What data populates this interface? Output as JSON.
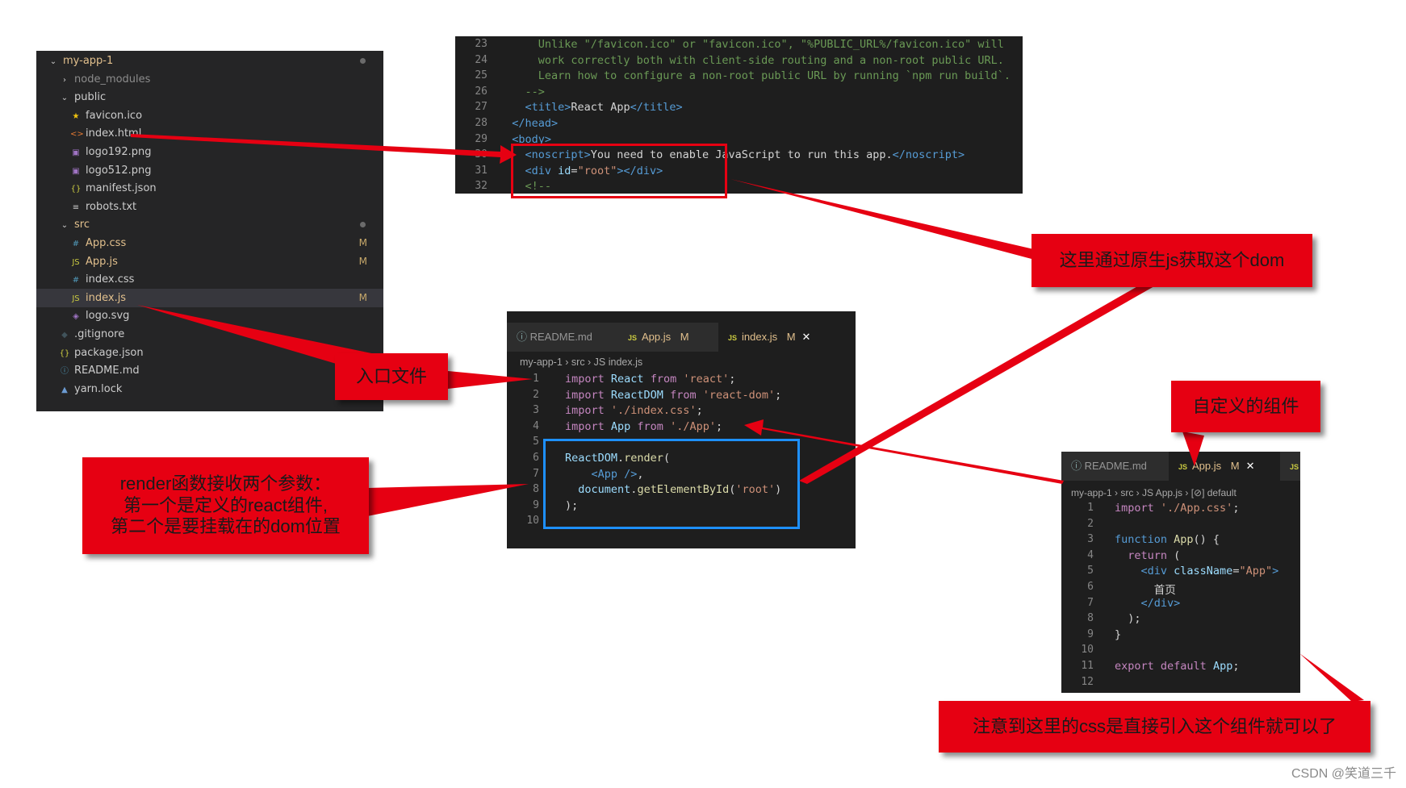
{
  "explorer": {
    "rows": [
      {
        "icon": "chevron-down",
        "label": "my-app-1",
        "badge": "",
        "dot": true,
        "indent": 0,
        "mod": true
      },
      {
        "icon": "chevron-right",
        "label": "node_modules",
        "badge": "",
        "dot": false,
        "indent": 1,
        "mod": false,
        "dim": true
      },
      {
        "icon": "chevron-down",
        "label": "public",
        "badge": "",
        "dot": false,
        "indent": 1,
        "mod": false
      },
      {
        "icon": "star",
        "label": "favicon.ico",
        "badge": "",
        "dot": false,
        "indent": 2,
        "mod": false
      },
      {
        "icon": "html",
        "label": "index.html",
        "badge": "",
        "dot": false,
        "indent": 2,
        "mod": false
      },
      {
        "icon": "image",
        "label": "logo192.png",
        "badge": "",
        "dot": false,
        "indent": 2,
        "mod": false
      },
      {
        "icon": "image",
        "label": "logo512.png",
        "badge": "",
        "dot": false,
        "indent": 2,
        "mod": false
      },
      {
        "icon": "json",
        "label": "manifest.json",
        "badge": "",
        "dot": false,
        "indent": 2,
        "mod": false
      },
      {
        "icon": "text",
        "label": "robots.txt",
        "badge": "",
        "dot": false,
        "indent": 2,
        "mod": false
      },
      {
        "icon": "chevron-down",
        "label": "src",
        "badge": "",
        "dot": true,
        "indent": 1,
        "mod": true
      },
      {
        "icon": "css",
        "label": "App.css",
        "badge": "M",
        "dot": false,
        "indent": 2,
        "mod": true
      },
      {
        "icon": "js",
        "label": "App.js",
        "badge": "M",
        "dot": false,
        "indent": 2,
        "mod": true
      },
      {
        "icon": "css",
        "label": "index.css",
        "badge": "",
        "dot": false,
        "indent": 2,
        "mod": false
      },
      {
        "icon": "js",
        "label": "index.js",
        "badge": "M",
        "dot": false,
        "indent": 2,
        "mod": true,
        "selected": true
      },
      {
        "icon": "svg",
        "label": "logo.svg",
        "badge": "",
        "dot": false,
        "indent": 2,
        "mod": false
      },
      {
        "icon": "git",
        "label": ".gitignore",
        "badge": "",
        "dot": false,
        "indent": 1,
        "mod": false
      },
      {
        "icon": "json",
        "label": "package.json",
        "badge": "",
        "dot": false,
        "indent": 1,
        "mod": false
      },
      {
        "icon": "info",
        "label": "README.md",
        "badge": "",
        "dot": false,
        "indent": 1,
        "mod": false
      },
      {
        "icon": "yarn",
        "label": "yarn.lock",
        "badge": "",
        "dot": false,
        "indent": 1,
        "mod": false
      }
    ]
  },
  "html_editor": {
    "lines": [
      {
        "n": "23",
        "segs": [
          [
            "cmt",
            "      Unlike \"/favicon.ico\" or \"favicon.ico\", \"%PUBLIC_URL%/favicon.ico\" will"
          ]
        ]
      },
      {
        "n": "24",
        "segs": [
          [
            "cmt",
            "      work correctly both with client-side routing and a non-root public URL."
          ]
        ]
      },
      {
        "n": "25",
        "segs": [
          [
            "cmt",
            "      Learn how to configure a non-root public URL by running `npm run build`."
          ]
        ]
      },
      {
        "n": "26",
        "segs": [
          [
            "cmt",
            "    -->"
          ]
        ]
      },
      {
        "n": "27",
        "segs": [
          [
            "txt",
            "    "
          ],
          [
            "tag",
            "<title>"
          ],
          [
            "txt",
            "React App"
          ],
          [
            "tag",
            "</title>"
          ]
        ]
      },
      {
        "n": "28",
        "segs": [
          [
            "txt",
            "  "
          ],
          [
            "tag",
            "</head>"
          ]
        ]
      },
      {
        "n": "29",
        "segs": [
          [
            "txt",
            "  "
          ],
          [
            "tag",
            "<body>"
          ]
        ]
      },
      {
        "n": "30",
        "segs": [
          [
            "txt",
            "    "
          ],
          [
            "tag",
            "<noscript>"
          ],
          [
            "txt",
            "You need to enable JavaScript to run this app."
          ],
          [
            "tag",
            "</noscript>"
          ]
        ]
      },
      {
        "n": "31",
        "segs": [
          [
            "txt",
            "    "
          ],
          [
            "tag",
            "<div "
          ],
          [
            "att",
            "id"
          ],
          [
            "txt",
            "="
          ],
          [
            "str",
            "\"root\""
          ],
          [
            "tag",
            "></div>"
          ]
        ]
      },
      {
        "n": "32",
        "segs": [
          [
            "cmt",
            "    <!--"
          ]
        ]
      }
    ]
  },
  "index_editor": {
    "tabs": [
      {
        "label": "README.md",
        "icon": "info",
        "badge": "",
        "active": false
      },
      {
        "label": "App.js",
        "icon": "JS",
        "badge": "M",
        "active": false
      },
      {
        "label": "index.js",
        "icon": "JS",
        "badge": "M",
        "active": true,
        "close": "✕"
      }
    ],
    "breadcrumb": "my-app-1 › src › JS index.js",
    "lines": [
      {
        "n": "1",
        "segs": [
          [
            "kw",
            "import "
          ],
          [
            "id",
            "React "
          ],
          [
            "kw",
            "from "
          ],
          [
            "str",
            "'react'"
          ],
          [
            "txt",
            ";"
          ]
        ]
      },
      {
        "n": "2",
        "segs": [
          [
            "kw",
            "import "
          ],
          [
            "id",
            "ReactDOM "
          ],
          [
            "kw",
            "from "
          ],
          [
            "str",
            "'react-dom'"
          ],
          [
            "txt",
            ";"
          ]
        ]
      },
      {
        "n": "3",
        "segs": [
          [
            "kw",
            "import "
          ],
          [
            "str",
            "'./index.css'"
          ],
          [
            "txt",
            ";"
          ]
        ]
      },
      {
        "n": "4",
        "segs": [
          [
            "kw",
            "import "
          ],
          [
            "id",
            "App "
          ],
          [
            "kw",
            "from "
          ],
          [
            "str",
            "'./App'"
          ],
          [
            "txt",
            ";"
          ]
        ]
      },
      {
        "n": "5",
        "segs": []
      },
      {
        "n": "6",
        "segs": [
          [
            "id",
            "ReactDOM"
          ],
          [
            "txt",
            "."
          ],
          [
            "fn",
            "render"
          ],
          [
            "txt",
            "("
          ]
        ]
      },
      {
        "n": "7",
        "segs": [
          [
            "txt",
            "    "
          ],
          [
            "tag",
            "<App "
          ],
          [
            "tag",
            "/>"
          ],
          [
            "txt",
            ","
          ]
        ]
      },
      {
        "n": "8",
        "segs": [
          [
            "txt",
            "  "
          ],
          [
            "id",
            "document"
          ],
          [
            "txt",
            "."
          ],
          [
            "fn",
            "getElementById"
          ],
          [
            "txt",
            "("
          ],
          [
            "str",
            "'root'"
          ],
          [
            "txt",
            ")"
          ]
        ]
      },
      {
        "n": "9",
        "segs": [
          [
            "txt",
            ");"
          ]
        ]
      },
      {
        "n": "10",
        "segs": []
      }
    ]
  },
  "app_editor": {
    "tabs": [
      {
        "label": "README.md",
        "icon": "info",
        "badge": "",
        "active": false
      },
      {
        "label": "App.js",
        "icon": "JS",
        "badge": "M",
        "active": true,
        "close": "✕"
      },
      {
        "label": "",
        "icon": "JS",
        "badge": "",
        "active": false
      }
    ],
    "breadcrumb": "my-app-1 › src › JS App.js › [⊘] default",
    "lines": [
      {
        "n": "1",
        "segs": [
          [
            "kw",
            "import "
          ],
          [
            "str",
            "'./App.css'"
          ],
          [
            "txt",
            ";"
          ]
        ]
      },
      {
        "n": "2",
        "segs": []
      },
      {
        "n": "3",
        "segs": [
          [
            "tag",
            "function "
          ],
          [
            "fn",
            "App"
          ],
          [
            "txt",
            "() {"
          ]
        ]
      },
      {
        "n": "4",
        "segs": [
          [
            "txt",
            "  "
          ],
          [
            "kw",
            "return "
          ],
          [
            "txt",
            "("
          ]
        ]
      },
      {
        "n": "5",
        "segs": [
          [
            "txt",
            "    "
          ],
          [
            "tag",
            "<div "
          ],
          [
            "att",
            "className"
          ],
          [
            "txt",
            "="
          ],
          [
            "str",
            "\"App\""
          ],
          [
            "tag",
            ">"
          ]
        ]
      },
      {
        "n": "6",
        "segs": [
          [
            "txt",
            "      首页"
          ]
        ]
      },
      {
        "n": "7",
        "segs": [
          [
            "txt",
            "    "
          ],
          [
            "tag",
            "</div>"
          ]
        ]
      },
      {
        "n": "8",
        "segs": [
          [
            "txt",
            "  );"
          ]
        ]
      },
      {
        "n": "9",
        "segs": [
          [
            "txt",
            "}"
          ]
        ]
      },
      {
        "n": "10",
        "segs": []
      },
      {
        "n": "11",
        "segs": [
          [
            "kw",
            "export "
          ],
          [
            "kw",
            "default "
          ],
          [
            "id",
            "App"
          ],
          [
            "txt",
            ";"
          ]
        ]
      },
      {
        "n": "12",
        "segs": []
      }
    ]
  },
  "notes": {
    "dom_note": "这里通过原生js获取这个dom",
    "entry_note": "入口文件",
    "render_note_l1": "render函数接收两个参数：",
    "render_note_l2": "第一个是定义的react组件,",
    "render_note_l3": "第二个是要挂载在的dom位置",
    "component_note": "自定义的组件",
    "css_note": "注意到这里的css是直接引入这个组件就可以了"
  },
  "credit": "CSDN @笑道三千",
  "colors": {
    "note_red": "#e60012",
    "blue_box": "#1e90ff",
    "editor_bg": "#1e1e1e"
  }
}
